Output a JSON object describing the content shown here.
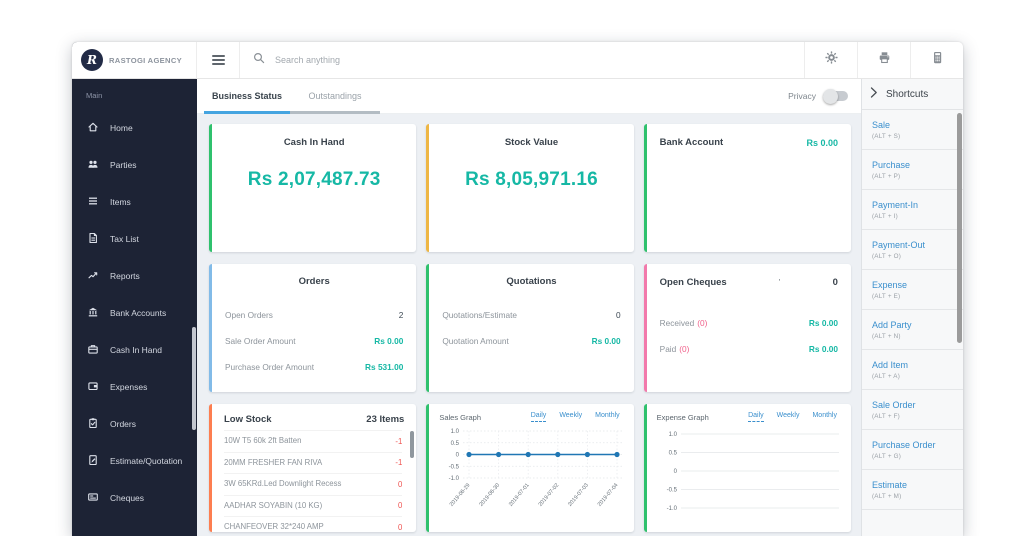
{
  "colors": {
    "money": "#16b8a5",
    "negative": "#ef5350",
    "pink_count": "#f0618b",
    "link_blue": "#3a8fcd",
    "tab_underline_active": "#45a4e0",
    "sidebar_bg": "#1d2335"
  },
  "brand": {
    "name": "RASTOGI AGENCY",
    "logo_letter": "R"
  },
  "sidebar": {
    "section_label": "Main",
    "items": [
      {
        "label": "Home",
        "icon": "home-icon"
      },
      {
        "label": "Parties",
        "icon": "people-icon"
      },
      {
        "label": "Items",
        "icon": "list-icon"
      },
      {
        "label": "Tax List",
        "icon": "tax-file-icon"
      },
      {
        "label": "Reports",
        "icon": "trend-icon"
      },
      {
        "label": "Bank Accounts",
        "icon": "bank-icon"
      },
      {
        "label": "Cash In Hand",
        "icon": "briefcase-icon"
      },
      {
        "label": "Expenses",
        "icon": "wallet-icon"
      },
      {
        "label": "Orders",
        "icon": "clipboard-icon"
      },
      {
        "label": "Estimate/Quotation",
        "icon": "estimate-icon"
      },
      {
        "label": "Cheques",
        "icon": "cheque-icon"
      }
    ]
  },
  "topbar": {
    "search_placeholder": "Search anything",
    "icons": [
      "hamburger-icon",
      "search-icon",
      "gear-icon",
      "printer-icon",
      "calculator-icon"
    ]
  },
  "tabbar": {
    "tabs": [
      {
        "label": "Business Status",
        "active": true
      },
      {
        "label": "Outstandings",
        "active": false
      }
    ],
    "privacy_label": "Privacy",
    "privacy_on": false
  },
  "shortcuts_panel": {
    "header": "Shortcuts",
    "items": [
      {
        "label": "Sale",
        "key": "(ALT + S)"
      },
      {
        "label": "Purchase",
        "key": "(ALT + P)"
      },
      {
        "label": "Payment-In",
        "key": "(ALT + I)"
      },
      {
        "label": "Payment-Out",
        "key": "(ALT + O)"
      },
      {
        "label": "Expense",
        "key": "(ALT + E)"
      },
      {
        "label": "Add Party",
        "key": "(ALT + N)"
      },
      {
        "label": "Add Item",
        "key": "(ALT + A)"
      },
      {
        "label": "Sale Order",
        "key": "(ALT + F)"
      },
      {
        "label": "Purchase Order",
        "key": "(ALT + G)"
      },
      {
        "label": "Estimate",
        "key": "(ALT + M)"
      }
    ]
  },
  "cards": {
    "cash_in_hand": {
      "title": "Cash In Hand",
      "value": "Rs 2,07,487.73",
      "accent": "#2fc16d"
    },
    "stock_value": {
      "title": "Stock Value",
      "value": "Rs 8,05,971.16",
      "accent": "#eeb644"
    },
    "bank_account": {
      "title": "Bank Account",
      "value": "Rs 0.00",
      "accent": "#2fc16d"
    },
    "orders": {
      "title": "Orders",
      "accent": "#82bbe8",
      "rows": [
        {
          "label": "Open Orders",
          "value": "2",
          "style": "plain"
        },
        {
          "label": "Sale Order Amount",
          "value": "Rs 0.00",
          "style": "money"
        },
        {
          "label": "Purchase Order Amount",
          "value": "Rs 531.00",
          "style": "money"
        }
      ]
    },
    "quotations": {
      "title": "Quotations",
      "accent": "#2fc16d",
      "rows": [
        {
          "label": "Quotations/Estimate",
          "value": "0",
          "style": "plain"
        },
        {
          "label": "Quotation Amount",
          "value": "Rs 0.00",
          "style": "money"
        }
      ]
    },
    "open_cheques": {
      "title": "Open Cheques",
      "stray_mark": "'",
      "count": "0",
      "accent": "#f279ab",
      "rows": [
        {
          "label": "Received",
          "count": "(0)",
          "value": "Rs 0.00",
          "style": "money"
        },
        {
          "label": "Paid",
          "count": "(0)",
          "value": "Rs 0.00",
          "style": "money"
        }
      ]
    },
    "low_stock": {
      "title": "Low Stock",
      "count": "23 Items",
      "accent": "#fd7e50",
      "items": [
        {
          "name": "10W T5 60k 2ft Batten",
          "qty": "-1"
        },
        {
          "name": "20MM FRESHER FAN RIVA",
          "qty": "-1"
        },
        {
          "name": "3W 65KRd.Led Downlight Recess",
          "qty": "0"
        },
        {
          "name": "AADHAR SOYABIN (10 KG)",
          "qty": "0"
        },
        {
          "name": "CHANFEOVER 32*240 AMP",
          "qty": "0"
        }
      ]
    }
  },
  "chart_data": [
    {
      "type": "line",
      "title": "Sales Graph",
      "tabs": [
        "Daily",
        "Weekly",
        "Monthly"
      ],
      "active_tab": "Daily",
      "accent": "#2fc16d",
      "x": [
        "2019-06-29",
        "2019-06-30",
        "2019-07-01",
        "2019-07-02",
        "2019-07-03",
        "2019-07-04"
      ],
      "series": [
        {
          "name": "Sales",
          "values": [
            0,
            0,
            0,
            0,
            0,
            0
          ]
        }
      ],
      "yticks": [
        "1.0",
        "0.5",
        "0",
        "-0.5",
        "-1.0"
      ],
      "ylim": [
        -1.0,
        1.0
      ],
      "grid": true,
      "legend": false,
      "line_color": "#2077b4"
    },
    {
      "type": "line",
      "title": "Expense Graph",
      "tabs": [
        "Daily",
        "Weekly",
        "Monthly"
      ],
      "active_tab": "Daily",
      "accent": "#2fc16d",
      "x": [],
      "series": [],
      "yticks": [
        "1.0",
        "0.5",
        "0",
        "-0.5",
        "-1.0"
      ],
      "ylim": [
        -1.0,
        1.0
      ],
      "grid": true,
      "legend": false,
      "line_color": "#2077b4"
    }
  ]
}
